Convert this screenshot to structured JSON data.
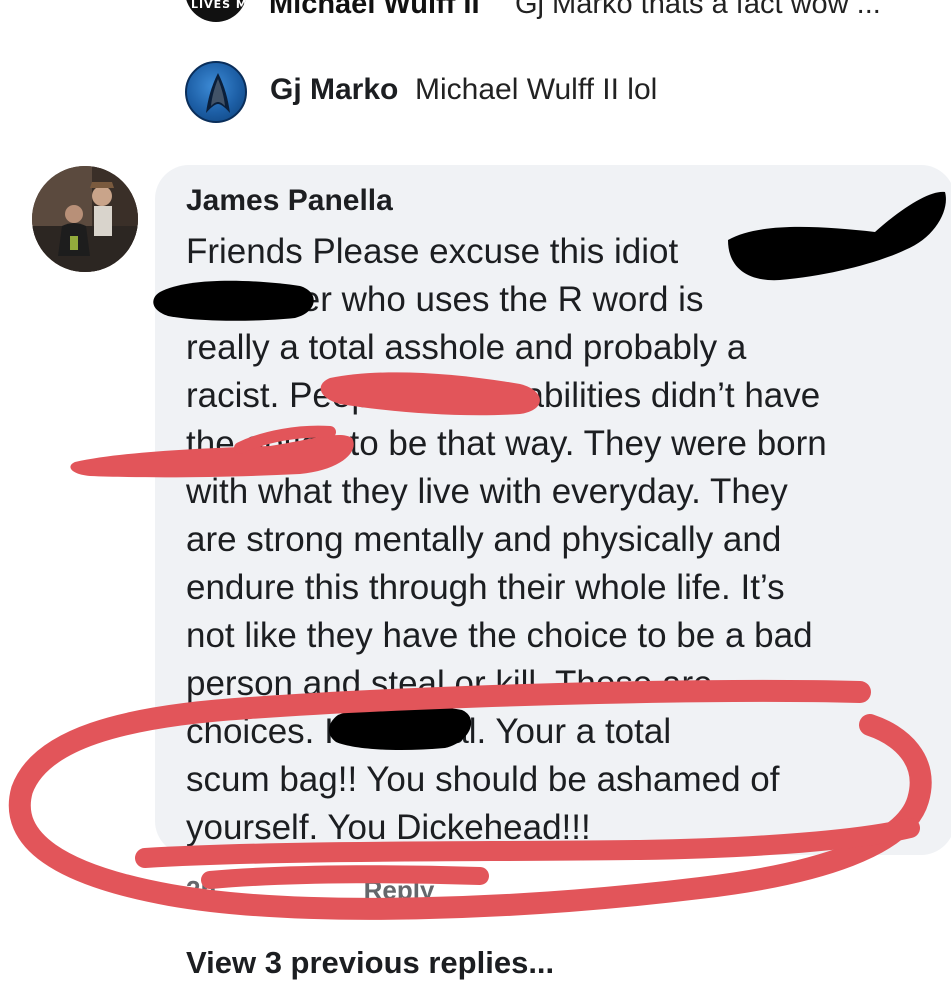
{
  "top_reply": {
    "name": "Michael Wulff II",
    "text": "Gj Marko thats a fact wow ...",
    "avatar_text": "LIVES MATTER",
    "avatar_icon": "lives-matter-badge"
  },
  "gj_reply": {
    "name": "Gj Marko",
    "text": "Michael Wulff II lol",
    "avatar_icon": "starfleet-insignia"
  },
  "comment": {
    "author": "James Panella",
    "lines": [
      "Friends Please excuse this idiot",
      "Any loser who uses the R word is",
      "really a total asshole and probably a",
      "racist. People with disabilities didn’t have",
      "the option to be that way. They were born",
      "with what they live with everyday. They",
      "are strong mentally and physically and",
      "endure this through their whole life. It’s",
      "not like they have the choice to be a bad",
      "person and steal or kill. Those are",
      "choices.  It’s official. Your a total",
      "scum bag!! You should be ashamed of",
      "yourself. You Dickehead!!!"
    ],
    "time": "2h",
    "reply_label": "Reply"
  },
  "view_previous": "View 3 previous replies...",
  "colors": {
    "bubble": "#f0f2f5",
    "text": "#1c1e21",
    "annotation_red": "#e2555a",
    "redaction": "#000000"
  }
}
